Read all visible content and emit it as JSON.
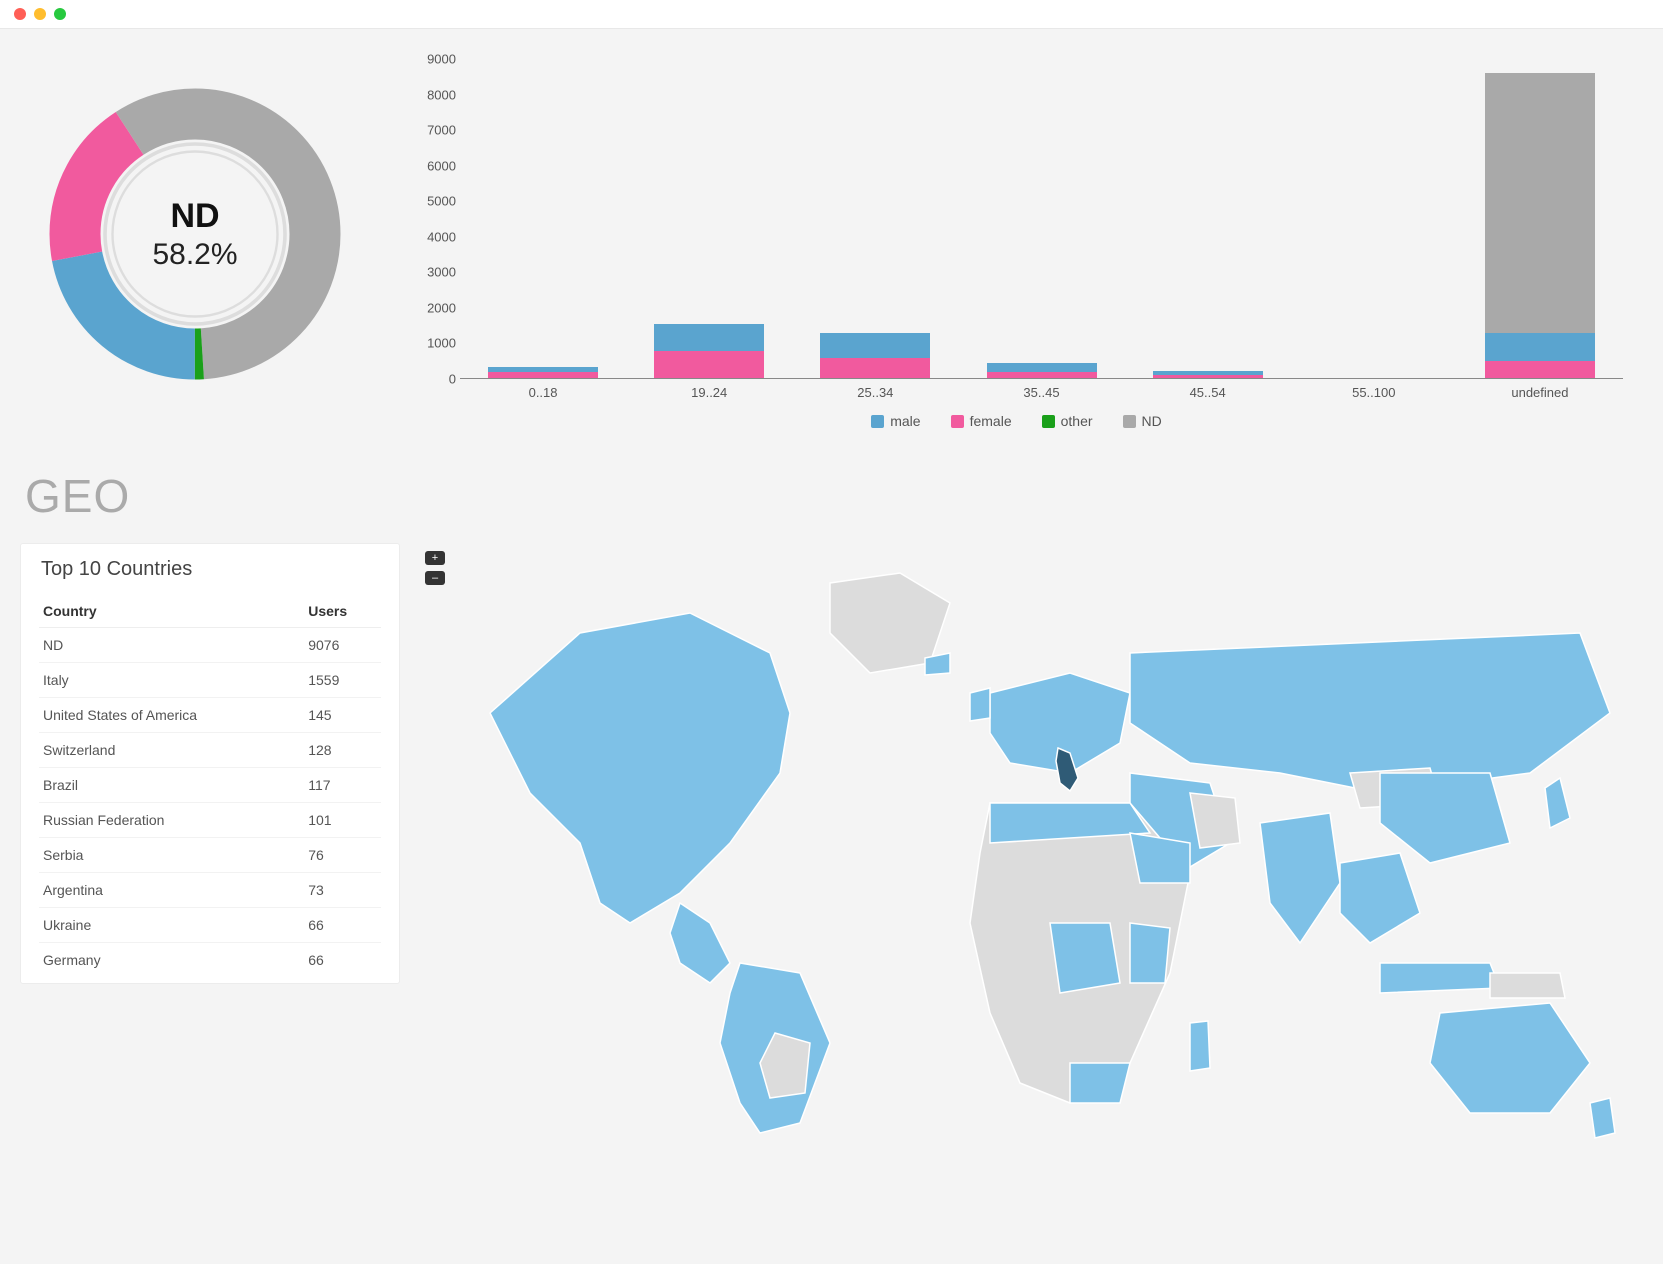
{
  "donut": {
    "center_label": "ND",
    "center_pct": "58.2%"
  },
  "bar_legend": [
    "male",
    "female",
    "other",
    "ND"
  ],
  "bar_colors": {
    "male": "#5aa4cf",
    "female": "#f15a9e",
    "other": "#1aa01a",
    "ND": "#a9a9a9"
  },
  "geo_heading": "GEO",
  "table": {
    "title": "Top 10 Countries",
    "cols": [
      "Country",
      "Users"
    ],
    "rows": [
      [
        "ND",
        "9076"
      ],
      [
        "Italy",
        "1559"
      ],
      [
        "United States of America",
        "145"
      ],
      [
        "Switzerland",
        "128"
      ],
      [
        "Brazil",
        "117"
      ],
      [
        "Russian Federation",
        "101"
      ],
      [
        "Serbia",
        "76"
      ],
      [
        "Argentina",
        "73"
      ],
      [
        "Ukraine",
        "66"
      ],
      [
        "Germany",
        "66"
      ]
    ]
  },
  "map_controls": {
    "zoom_in": "+",
    "zoom_out": "–"
  },
  "chart_data": [
    {
      "type": "pie",
      "title": "",
      "hole": 0.6,
      "series": [
        {
          "name": "male",
          "value": 22.0,
          "color": "#5aa4cf"
        },
        {
          "name": "female",
          "value": 18.8,
          "color": "#f15a9e"
        },
        {
          "name": "ND",
          "value": 58.2,
          "color": "#a9a9a9"
        },
        {
          "name": "other",
          "value": 1.0,
          "color": "#1aa01a"
        }
      ],
      "center_label": "ND",
      "center_value": "58.2%"
    },
    {
      "type": "bar",
      "stacked": true,
      "categories": [
        "0..18",
        "19..24",
        "25..34",
        "35..45",
        "45..54",
        "55..100",
        "undefined"
      ],
      "series": [
        {
          "name": "male",
          "color": "#5aa4cf",
          "values": [
            150,
            750,
            700,
            250,
            120,
            20,
            800
          ]
        },
        {
          "name": "female",
          "color": "#f15a9e",
          "values": [
            200,
            800,
            600,
            200,
            100,
            20,
            500
          ]
        },
        {
          "name": "other",
          "color": "#1aa01a",
          "values": [
            0,
            0,
            0,
            0,
            0,
            0,
            0
          ]
        },
        {
          "name": "ND",
          "color": "#a9a9a9",
          "values": [
            0,
            0,
            0,
            0,
            0,
            0,
            7300
          ]
        }
      ],
      "ylabel": "",
      "xlabel": "",
      "ylim": [
        0,
        9000
      ],
      "yticks": [
        0,
        1000,
        2000,
        3000,
        4000,
        5000,
        6000,
        7000,
        8000,
        9000
      ],
      "legend": [
        "male",
        "female",
        "other",
        "ND"
      ]
    },
    {
      "type": "table",
      "title": "Top 10 Countries",
      "columns": [
        "Country",
        "Users"
      ],
      "rows": [
        [
          "ND",
          9076
        ],
        [
          "Italy",
          1559
        ],
        [
          "United States of America",
          145
        ],
        [
          "Switzerland",
          128
        ],
        [
          "Brazil",
          117
        ],
        [
          "Russian Federation",
          101
        ],
        [
          "Serbia",
          76
        ],
        [
          "Argentina",
          73
        ],
        [
          "Ukraine",
          66
        ],
        [
          "Germany",
          66
        ]
      ]
    }
  ]
}
